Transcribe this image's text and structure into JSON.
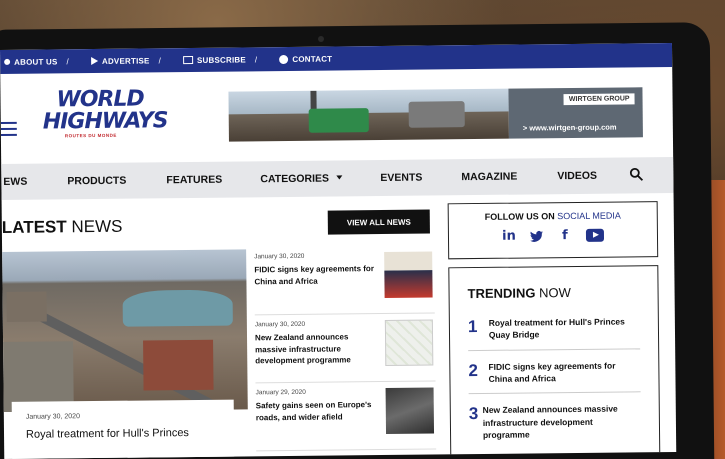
{
  "topbar": {
    "items": [
      {
        "label": "ABOUT US",
        "icon": "person-icon"
      },
      {
        "label": "ADVERTISE",
        "icon": "arrow-icon"
      },
      {
        "label": "SUBSCRIBE",
        "icon": "book-icon"
      },
      {
        "label": "CONTACT",
        "icon": "contact-icon"
      }
    ],
    "separator": "/"
  },
  "header": {
    "logo_line1": "WORLD",
    "logo_line2": "HIGHWAYS",
    "logo_tag": "ROUTES DU MONDE",
    "banner": {
      "brand": "WIRTGEN GROUP",
      "url": "> www.wirtgen-group.com"
    }
  },
  "nav": {
    "items": [
      "EWS",
      "PRODUCTS",
      "FEATURES",
      "CATEGORIES",
      "EVENTS",
      "MAGAZINE",
      "VIDEOS"
    ]
  },
  "latest": {
    "title_bold": "LATEST",
    "title_rest": " NEWS",
    "view_all": "VIEW ALL NEWS",
    "hero": {
      "date": "January 30, 2020",
      "title": "Royal treatment for Hull's Princes"
    },
    "items": [
      {
        "date": "January 30, 2020",
        "title": "FIDIC signs key agreements for China and Africa"
      },
      {
        "date": "January 30, 2020",
        "title": "New Zealand announces massive infrastructure development programme"
      },
      {
        "date": "January 29, 2020",
        "title": "Safety gains seen on Europe's roads, and wider afield"
      }
    ]
  },
  "follow": {
    "label_bold": "FOLLOW US ON ",
    "label_rest": "SOCIAL MEDIA",
    "icons": [
      "linkedin-icon",
      "twitter-icon",
      "facebook-icon",
      "youtube-icon"
    ]
  },
  "trending": {
    "title_bold": "TRENDING",
    "title_rest": " NOW",
    "items": [
      {
        "num": "1",
        "title": "Royal treatment for Hull's Princes Quay Bridge"
      },
      {
        "num": "2",
        "title": "FIDIC signs key agreements for China and Africa"
      },
      {
        "num": "3",
        "title": "New Zealand announces massive infrastructure development programme"
      }
    ]
  },
  "colors": {
    "brand_blue": "#22338a",
    "nav_bg": "#e6e7ea",
    "button_black": "#111111"
  }
}
